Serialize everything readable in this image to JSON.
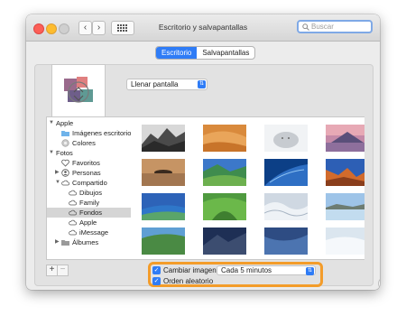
{
  "window": {
    "title": "Escritorio y salvapantallas"
  },
  "toolbar": {
    "back_icon": "‹",
    "forward_icon": "›",
    "search_placeholder": "Buscar"
  },
  "tabs": [
    {
      "label": "Escritorio",
      "active": true
    },
    {
      "label": "Salvapantallas",
      "active": false
    }
  ],
  "fit_popup": {
    "value": "Llenar pantalla"
  },
  "sidebar": {
    "items": [
      {
        "label": "Apple",
        "icon": "disclosure-open"
      },
      {
        "label": "Imágenes escritorio",
        "icon": "folder-icon"
      },
      {
        "label": "Colores",
        "icon": "color-wheel-icon"
      },
      {
        "label": "Fotos",
        "icon": "disclosure-open"
      },
      {
        "label": "Favoritos",
        "icon": "heart-icon"
      },
      {
        "label": "Personas",
        "icon": "person-icon"
      },
      {
        "label": "Compartido",
        "icon": "cloud-icon"
      },
      {
        "label": "Dibujos",
        "icon": "cloud-icon"
      },
      {
        "label": "Family",
        "icon": "cloud-icon"
      },
      {
        "label": "Fondos",
        "icon": "cloud-icon",
        "selected": true
      },
      {
        "label": "Apple",
        "icon": "cloud-icon"
      },
      {
        "label": "iMessage",
        "icon": "cloud-icon"
      },
      {
        "label": "Álbumes",
        "icon": "folder-icon"
      }
    ]
  },
  "wallpapers": [
    "mountain-bw",
    "desert-dune",
    "snow-leopard",
    "purple-mountain",
    "island-reflection",
    "green-valley",
    "earth-blue",
    "desert-canyon",
    "blue-fields",
    "green-hills",
    "white-waves",
    "lake-sky",
    "green-coast",
    "night-mountain",
    "blue-marble",
    "white-ice"
  ],
  "bottom_buttons": {
    "add": "+",
    "remove": "−"
  },
  "options": {
    "change_picture_label": "Cambiar imagen:",
    "change_picture_checked": true,
    "interval_value": "Cada 5 minutos",
    "random_order_label": "Orden aleatorio",
    "random_order_checked": true
  },
  "help_label": "?",
  "colors": {
    "accent": "#2f7cf6",
    "highlight": "#f39c2a"
  }
}
